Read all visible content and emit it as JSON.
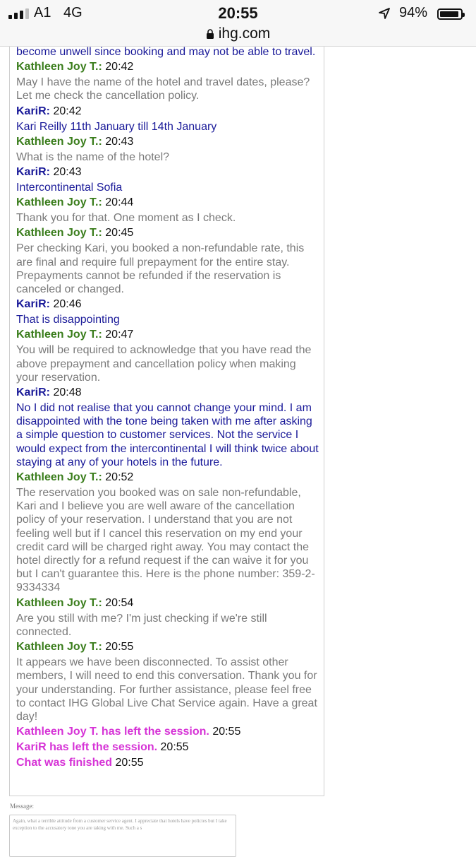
{
  "status_bar": {
    "carrier": "A1",
    "network": "4G",
    "time": "20:55",
    "battery": "94%",
    "battery_level": 0.94,
    "icons": [
      "signal-icon",
      "location-arrow-icon",
      "battery-icon"
    ]
  },
  "browser": {
    "url": "ihg.com",
    "icons": [
      "lock-icon"
    ]
  },
  "chat": {
    "partial_top": "become unwell since booking and may not be able to travel.",
    "messages": [
      {
        "role": "agent",
        "name": "Kathleen Joy T.:",
        "time": "20:42",
        "text": "May I have the name of the hotel and travel dates, please? Let me check the cancellation policy."
      },
      {
        "role": "user",
        "name": "KariR:",
        "time": "20:42",
        "text": "Kari Reilly 11th January till 14th January"
      },
      {
        "role": "agent",
        "name": "Kathleen Joy T.:",
        "time": "20:43",
        "text": "What is the name of the hotel?"
      },
      {
        "role": "user",
        "name": "KariR:",
        "time": "20:43",
        "text": "Intercontinental Sofia"
      },
      {
        "role": "agent",
        "name": "Kathleen Joy T.:",
        "time": "20:44",
        "text": "Thank you for that. One moment as I check."
      },
      {
        "role": "agent",
        "name": "Kathleen Joy T.:",
        "time": "20:45",
        "text": "Per checking Kari, you booked a non-refundable rate, this are final and require full prepayment for the entire stay. Prepayments cannot be refunded if the reservation is canceled or changed."
      },
      {
        "role": "user",
        "name": "KariR:",
        "time": "20:46",
        "text": "That is disappointing"
      },
      {
        "role": "agent",
        "name": "Kathleen Joy T.:",
        "time": "20:47",
        "text": "You will be required to acknowledge that you have read the above prepayment and cancellation policy when making your reservation."
      },
      {
        "role": "user",
        "name": "KariR:",
        "time": "20:48",
        "text": "No I did not realise that you cannot change your mind. I am disappointed with the tone being taken with me after asking a simple question to customer services. Not the service I would expect from the intercontinental I will think twice about staying at any of your hotels in the future."
      },
      {
        "role": "agent",
        "name": "Kathleen Joy T.:",
        "time": "20:52",
        "text": "The reservation you booked was on sale non-refundable, Kari and I believe you are well aware of the cancellation policy of your reservation. I understand that you are not feeling well but if I cancel this reservation on my end your credit card will be charged right away. You may contact the hotel directly for a refund request if the can waive it for you but I can't guarantee this. Here is the phone number: 359-2-9334334"
      },
      {
        "role": "agent",
        "name": "Kathleen Joy T.:",
        "time": "20:54",
        "text": "Are you still with me? I'm just checking if we're still connected."
      },
      {
        "role": "agent",
        "name": "Kathleen Joy T.:",
        "time": "20:55",
        "text": "It appears we have been disconnected. To assist other members, I will need to end this conversation. Thank you for your understanding. For further assistance, please feel free to contact IHG Global Live Chat Service again. Have a great day!"
      }
    ],
    "system_events": [
      {
        "text": "Kathleen Joy T. has left the session.",
        "time": "20:55"
      },
      {
        "text": "KariR has left the session.",
        "time": "20:55"
      },
      {
        "text": "Chat was finished",
        "time": "20:55"
      }
    ]
  },
  "composer": {
    "label": "Message:",
    "value": "Again, what a terrible attitude from a customer service agent. I appreciate that hotels have policies but I take exception to the accusatory tone you are taking with me. Such a s"
  },
  "colors": {
    "agent_name": "#3a7d1c",
    "user_text": "#1a1a99",
    "agent_text": "#7a7a7a",
    "system_text": "#d633d6"
  }
}
